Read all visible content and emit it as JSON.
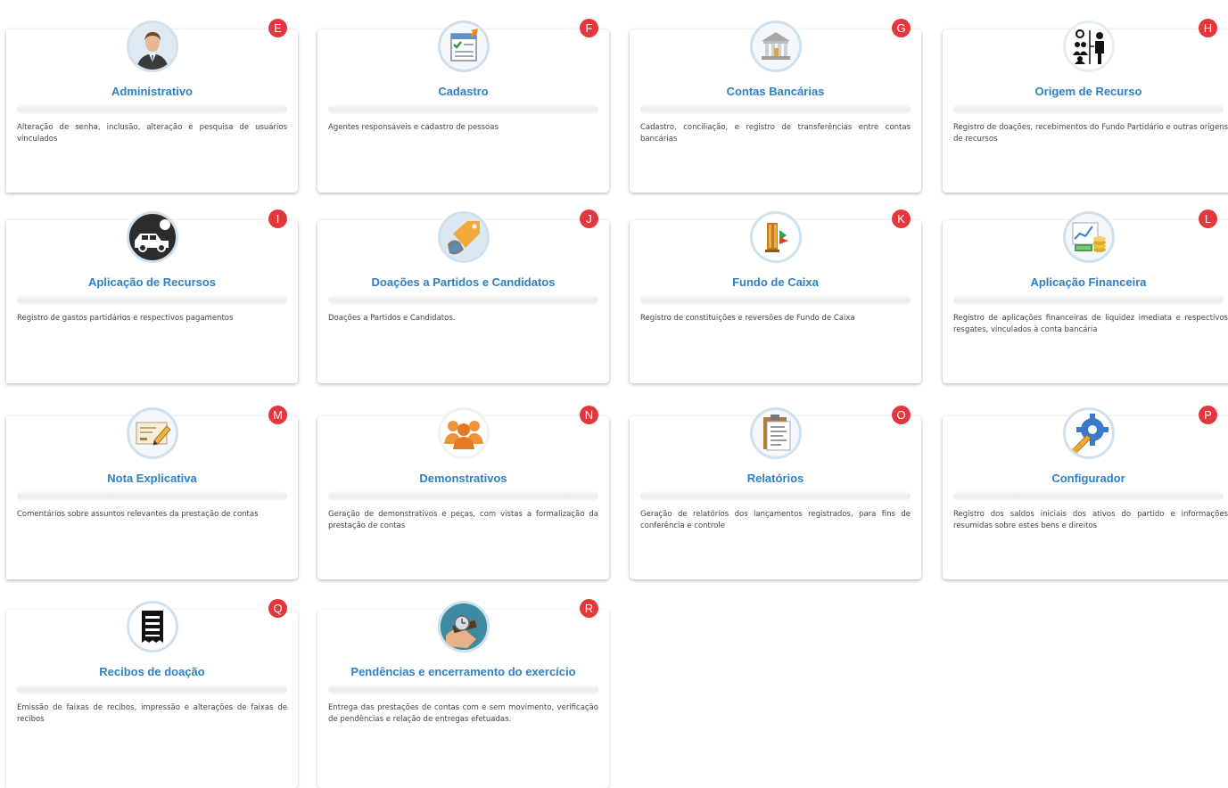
{
  "cards": [
    {
      "badge": "E",
      "title": "Administrativo",
      "description": "Alteração de senha, inclusão, alteração e pesquisa de usuários vinculados",
      "icon": "user-avatar-icon"
    },
    {
      "badge": "F",
      "title": "Cadastro",
      "description": "Agentes responsáveis e cadastro de pessoas",
      "icon": "checklist-form-icon"
    },
    {
      "badge": "G",
      "title": "Contas Bancárias",
      "description": "Cadastro, conciliação, e registro de transferências entre contas bancárias",
      "icon": "bank-building-icon"
    },
    {
      "badge": "H",
      "title": "Origem de Recurso",
      "description": "Registro de doações, recebimentos do Fundo Partidário e outras origens de recursos",
      "icon": "people-source-icon"
    },
    {
      "badge": "I",
      "title": "Aplicação de Recursos",
      "description": "Registro de gastos partidários e respectivos pagamentos",
      "icon": "vehicle-spending-icon"
    },
    {
      "badge": "J",
      "title": "Doações a Partidos e Candidatos",
      "description": "Doações a Partidos e Candidatos.",
      "icon": "tag-donation-icon"
    },
    {
      "badge": "K",
      "title": "Fundo de Caixa",
      "description": "Registro de constituições e reversões de Fundo de Caixa",
      "icon": "cash-fund-icon"
    },
    {
      "badge": "L",
      "title": "Aplicação Financeira",
      "description": "Registro de aplicações financeiras de liquidez imediata e respectivos resgates, vinculados à conta bancária",
      "icon": "investment-coins-icon"
    },
    {
      "badge": "M",
      "title": "Nota Explicativa",
      "description": "Comentários sobre assuntos relevantes da prestação de contas",
      "icon": "note-pencil-icon"
    },
    {
      "badge": "N",
      "title": "Demonstrativos",
      "description": "Geração de demonstrativos e peças, com vistas a formalização da prestação de contas",
      "icon": "group-people-icon"
    },
    {
      "badge": "O",
      "title": "Relatórios",
      "description": "Geração de relatórios dos lançamentos registrados, para fins de conferência e controle",
      "icon": "clipboard-report-icon"
    },
    {
      "badge": "P",
      "title": "Configurador",
      "description": "Registro dos saldos iniciais dos ativos do partido e informações resumidas sobre estes bens e direitos",
      "icon": "gear-wrench-icon"
    },
    {
      "badge": "Q",
      "title": "Recibos de doação",
      "description": "Emissão de faixas de recibos, impressão e alterações de faixas de recibos",
      "icon": "receipt-icon"
    },
    {
      "badge": "R",
      "title": "Pendências e encerramento do exercício",
      "description": "Entrega das prestações de contas com e sem movimento, verificação de pendências e relação de entregas efetuadas.",
      "icon": "wristwatch-icon"
    }
  ],
  "colors": {
    "title": "#2e7fc4",
    "badge": "#e2373c"
  }
}
